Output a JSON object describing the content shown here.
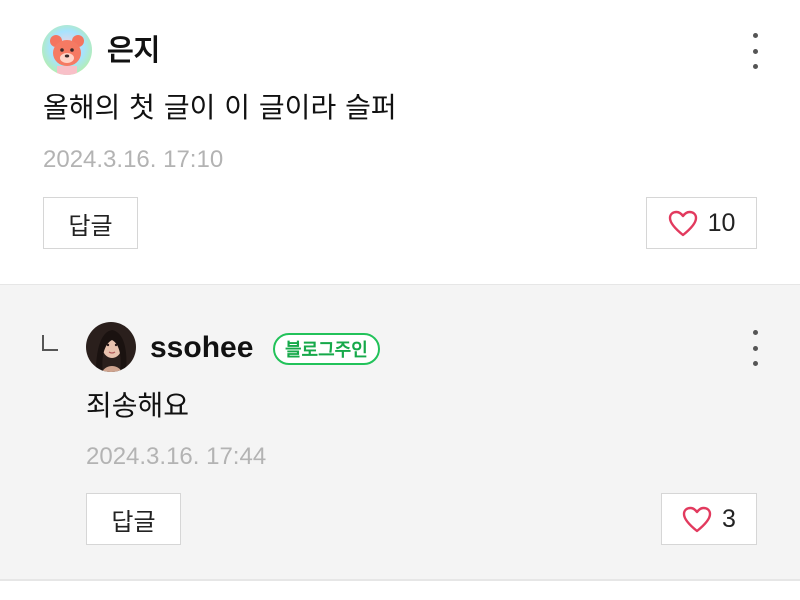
{
  "comments": [
    {
      "author": "은지",
      "text": "올해의 첫 글이 이 글이라 슬퍼",
      "timestamp": "2024.3.16. 17:10",
      "reply_label": "답글",
      "like_count": "10"
    },
    {
      "author": "ssohee",
      "badge": "블로그주인",
      "text": "죄송해요",
      "timestamp": "2024.3.16. 17:44",
      "reply_label": "답글",
      "like_count": "3"
    }
  ],
  "colors": {
    "badge_green": "#22c25a",
    "heart_red": "#e23a5e",
    "timestamp_gray": "#b3b3b3",
    "reply_background": "#f4f4f4"
  }
}
